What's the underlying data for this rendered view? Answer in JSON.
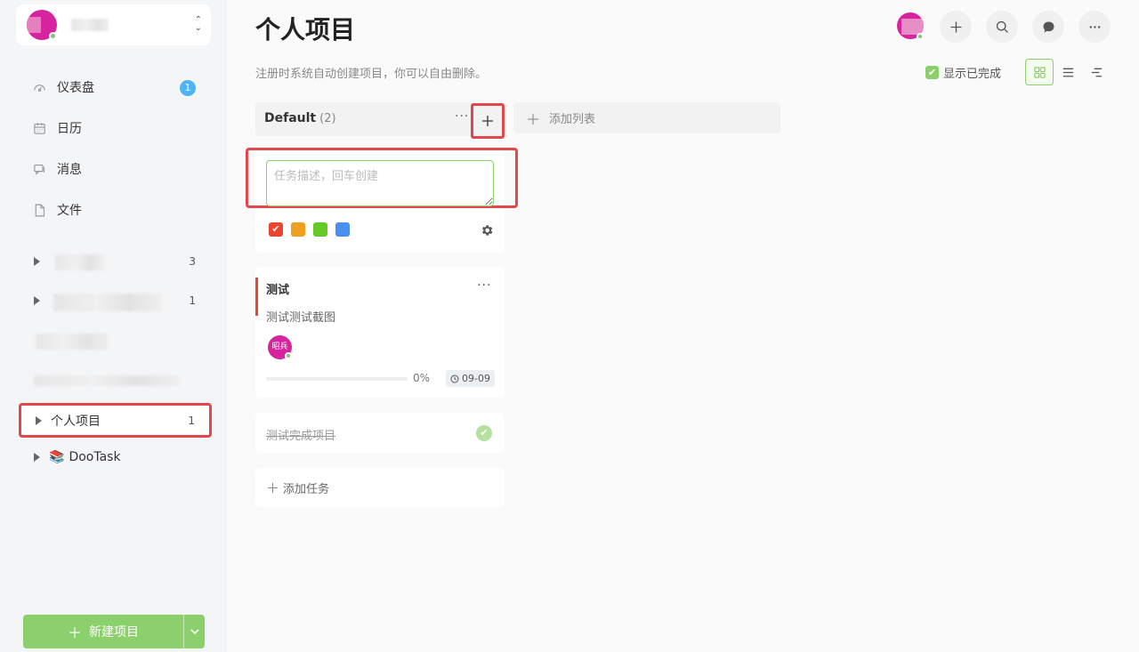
{
  "sidebar": {
    "nav": [
      {
        "label": "仪表盘",
        "icon": "dashboard-icon",
        "badge": "1"
      },
      {
        "label": "日历",
        "icon": "calendar-icon"
      },
      {
        "label": "消息",
        "icon": "message-icon"
      },
      {
        "label": "文件",
        "icon": "file-icon"
      }
    ],
    "projects": [
      {
        "label": "",
        "count": "3"
      },
      {
        "label": "",
        "count": "1"
      },
      {
        "label": "",
        "count": ""
      },
      {
        "label": "",
        "count": ""
      },
      {
        "label": "个人项目",
        "count": "1",
        "active": true
      },
      {
        "label": "DooTask",
        "count": "",
        "icon": "books-icon"
      }
    ],
    "new_project_label": "新建项目"
  },
  "header": {
    "title": "个人项目",
    "description": "注册时系统自动创建项目，你可以自由删除。",
    "show_completed_label": "显示已完成"
  },
  "column": {
    "title": "Default",
    "count": "(2)",
    "add_list_label": "添加列表",
    "new_task_placeholder": "任务描述，回车创建",
    "colors": [
      "#e9442e",
      "#f0a020",
      "#63c926",
      "#4a8ff0"
    ]
  },
  "task": {
    "title": "测试",
    "description": "测试测试截图",
    "assignee": "昭兵",
    "progress_text": "0%",
    "progress_value": 0,
    "due": "09-09",
    "accent": "#e9442e"
  },
  "completed_task": {
    "title": "测试完成项目"
  },
  "add_task_label": "添加任务"
}
